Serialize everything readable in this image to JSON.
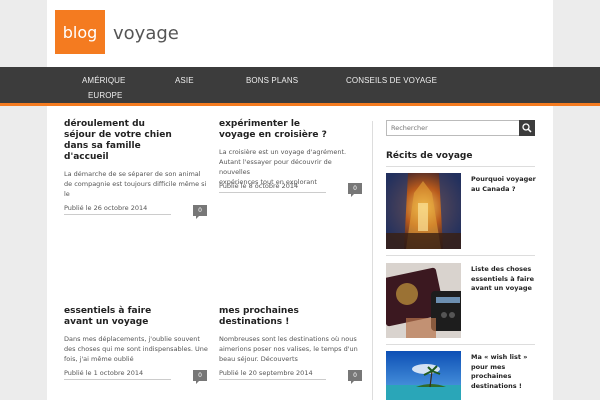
{
  "header": {
    "logo_box_text": "blog",
    "logo_text": "voyage",
    "accent_color": "#f47b20"
  },
  "nav": {
    "items": [
      "AMÉRIQUE",
      "ASIE",
      "BONS PLANS",
      "CONSEILS DE VOYAGE",
      "EUROPE"
    ]
  },
  "posts": [
    {
      "title_lines": [
        "déroulement du",
        "séjour de votre chien",
        "dans sa famille",
        "d'accueil"
      ],
      "excerpt_lines": [
        "La démarche de se séparer de son animal",
        "de compagnie est toujours difficile même si",
        "le"
      ],
      "meta": "Publié le 26 octobre 2014",
      "comments": "0"
    },
    {
      "title_lines": [
        "expérimenter le",
        "voyage en croisière ?"
      ],
      "excerpt_lines": [
        "La croisière est un voyage d'agrément.",
        "Autant l'essayer pour découvrir de nouvelles",
        "expériences tout en explorant"
      ],
      "meta": "Publié le 8 octobre 2014",
      "comments": "0"
    },
    {
      "title_lines": [
        "essentiels à faire",
        "avant un voyage"
      ],
      "excerpt_lines": [
        "Dans mes déplacements, j'oublie souvent",
        "des choses qui me sont indispensables. Une",
        "fois, j'ai même oublié"
      ],
      "meta": "Publié le 1 octobre 2014",
      "comments": "0"
    },
    {
      "title_lines": [
        "mes prochaines",
        "destinations !"
      ],
      "excerpt_lines": [
        "Nombreuses sont les destinations où nous",
        "aimerions poser nos valises, le temps d'un",
        "beau séjour. Découverts"
      ],
      "meta": "Publié le 20 septembre 2014",
      "comments": "0"
    }
  ],
  "sidebar": {
    "search_placeholder": "Rechercher",
    "recits_title": "Récits de voyage",
    "recits": [
      {
        "title_lines": [
          "Pourquoi voyager",
          "au Canada ?"
        ],
        "image": "cathedral-photo"
      },
      {
        "title_lines": [
          "Liste des choses",
          "essentiels à faire",
          "avant un voyage"
        ],
        "image": "passport-photo"
      },
      {
        "title_lines": [
          "Ma « wish list »",
          "pour mes",
          "prochaines",
          "destinations !"
        ],
        "image": "beach-photo"
      }
    ]
  }
}
